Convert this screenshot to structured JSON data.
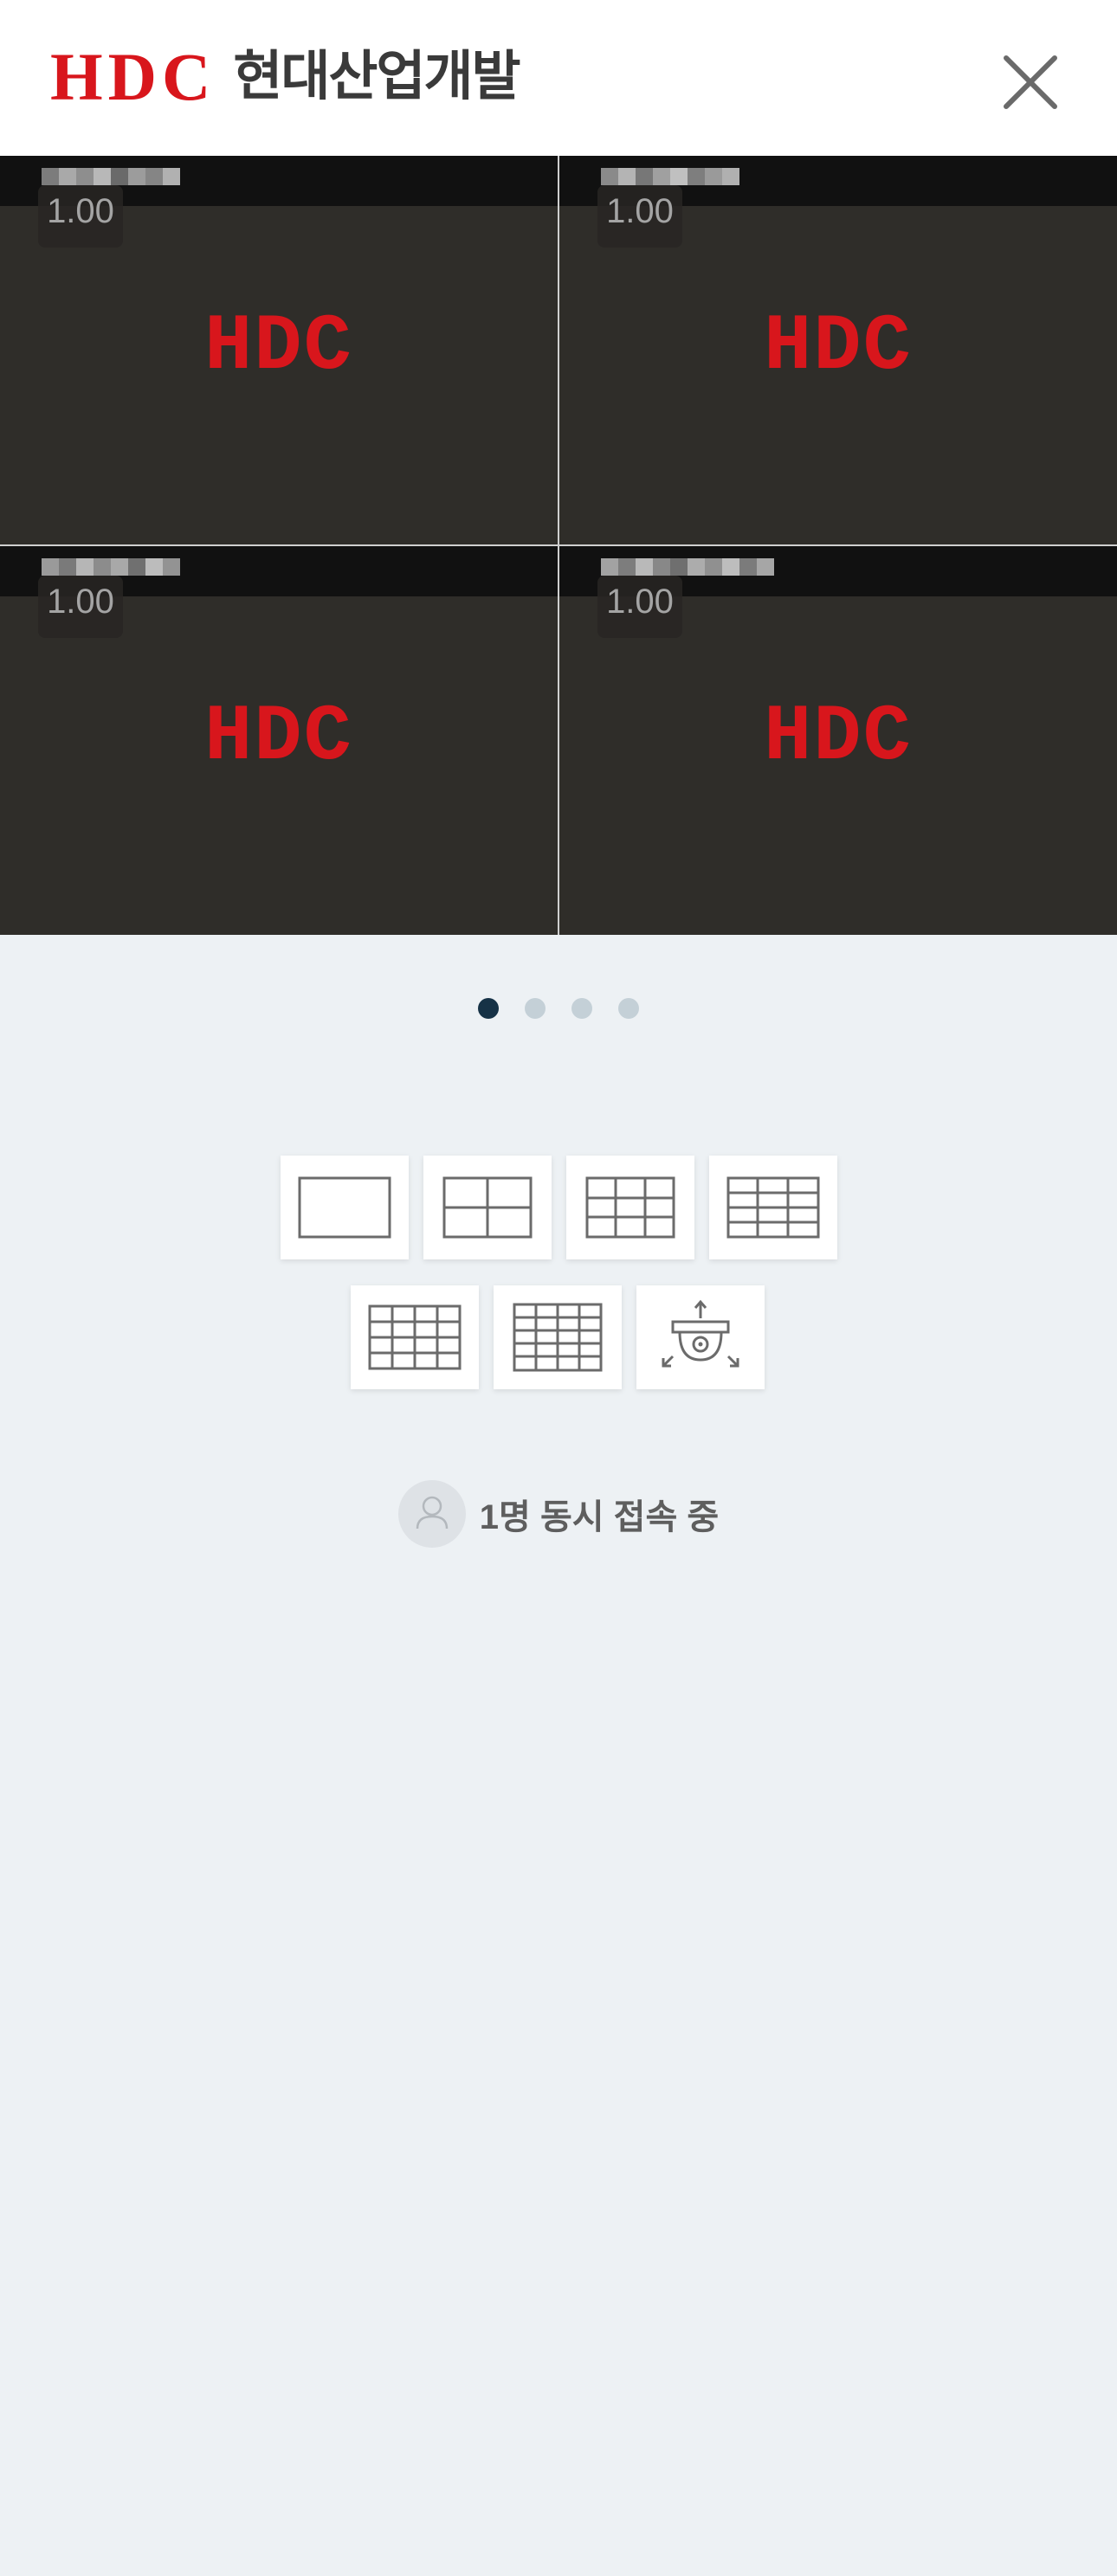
{
  "header": {
    "logo_mark": "HDC",
    "logo_text": "현대산업개발",
    "brand_color": "#d8161c",
    "close_icon": "close-icon"
  },
  "cameras": [
    {
      "speed": "1.00",
      "watermark": "HDC"
    },
    {
      "speed": "1.00",
      "watermark": "HDC"
    },
    {
      "speed": "1.00",
      "watermark": "HDC"
    },
    {
      "speed": "1.00",
      "watermark": "HDC"
    }
  ],
  "pager": {
    "pages": 4,
    "current": 1,
    "active_color": "#163246",
    "inactive_color": "#c4d0d7"
  },
  "layouts": [
    {
      "name": "layout-1x1-icon"
    },
    {
      "name": "layout-2x2-icon"
    },
    {
      "name": "layout-3x3-icon"
    },
    {
      "name": "layout-3x4-icon"
    },
    {
      "name": "layout-4x4-icon"
    },
    {
      "name": "layout-4x5-icon"
    },
    {
      "name": "ptz-camera-icon"
    }
  ],
  "status": {
    "concurrent_users": "1명 동시 접속 중"
  }
}
